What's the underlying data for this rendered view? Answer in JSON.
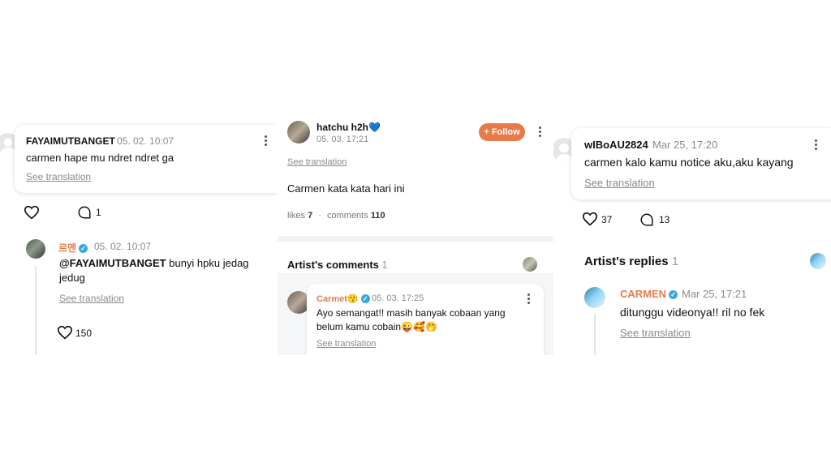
{
  "panel1": {
    "comment": {
      "username": "FAYAIMUTBANGET",
      "date": "05. 02. 10:07",
      "text": "carmen hape mu ndret ndret ga",
      "see_translation": "See translation",
      "reply_count": "1"
    },
    "reply": {
      "username": "르멘",
      "date": "05. 02. 10:07",
      "mention": "@FAYAIMUTBANGET",
      "text_rest": " bunyi hpku jedag",
      "text_line2": "jedug",
      "see_translation": "See translation",
      "likes": "150"
    }
  },
  "panel2": {
    "post": {
      "username": "hatchu h2h💙",
      "date": "05. 03. 17:21",
      "follow_label": "+ Follow",
      "see_translation": "See translation",
      "text": "Carmen kata kata hari ini",
      "likes_label": "likes",
      "likes": "7",
      "comments_label": "comments",
      "comments": "110"
    },
    "artist_section": {
      "title": "Artist's comments",
      "count": "1"
    },
    "artist_comment": {
      "username": "Carmet😗",
      "date": "05. 03. 17:25",
      "text_line1": "Ayo semangat!! masih banyak cobaan yang",
      "text_line2": "belum kamu cobain😜🥰🤭",
      "see_translation": "See translation"
    }
  },
  "panel3": {
    "comment": {
      "username": "wIBoAU2824",
      "date": "Mar 25, 17:20",
      "text": "carmen kalo kamu notice aku,aku kayang",
      "see_translation": "See translation",
      "likes": "37",
      "replies": "13"
    },
    "artist_section": {
      "title": "Artist's replies",
      "count": "1"
    },
    "reply": {
      "username": "CARMEN",
      "date": "Mar 25, 17:21",
      "text": "ditunggu videonya!! ril no fek",
      "see_translation": "See translation"
    }
  },
  "colors": {
    "accent": "#e87a4a",
    "verified": "#3aa7e0",
    "muted": "#8a8a8a"
  }
}
